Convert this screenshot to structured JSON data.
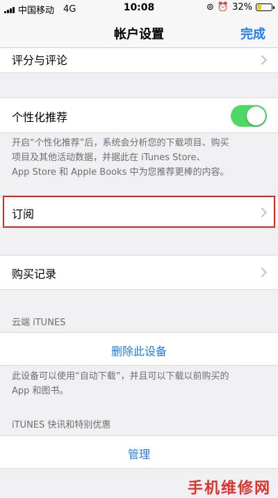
{
  "status_bar": {
    "carrier": "中国移动",
    "network": "4G",
    "time": "10:08",
    "battery_percent_label": "32%",
    "battery_level": 0.32,
    "battery_color": "#f5c518"
  },
  "nav": {
    "title": "帐户设置",
    "done_label": "完成"
  },
  "rows": {
    "ratings_label": "评分与评论",
    "personalized_label": "个性化推荐",
    "personalized_on": true,
    "subscriptions_label": "订阅",
    "purchase_history_label": "购买记录",
    "remove_device_label": "删除此设备",
    "manage_label": "管理"
  },
  "descriptions": {
    "personalized_line1": "开启“个性化推荐”后，系统会分析您的下载项目、购买",
    "personalized_line2": "项目及其他活动数据，并据此在 iTunes Store、",
    "personalized_line3": "App Store 和 Apple Books 中为您推荐更棒的内容。",
    "device_line1": "此设备可以使用“自动下载”，并且可以下载以前购买的",
    "device_line2": "App 和图书。"
  },
  "headers": {
    "itunes_cloud": "云端 iTUNES",
    "itunes_news": "iTUNES 快讯和特别优惠"
  },
  "watermark": "手机维修网",
  "colors": {
    "accent": "#1f7cf3",
    "toggle_on": "#4cd964",
    "highlight": "#e1251b"
  },
  "icons": {
    "chevron": "chevron-right-icon",
    "alarm": "alarm-icon",
    "rotation_lock": "rotation-lock-icon",
    "battery": "battery-icon",
    "signal": "signal-icon"
  }
}
